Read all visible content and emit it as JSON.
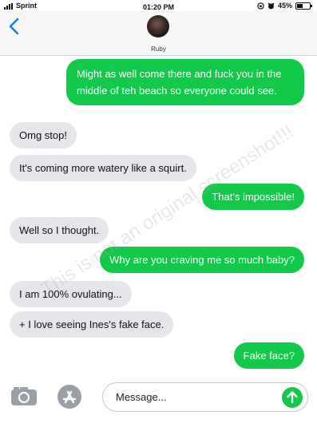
{
  "status_bar": {
    "carrier": "Sprint",
    "time": "01:20 PM",
    "battery_percent": "45%",
    "battery_level": 0.45
  },
  "header": {
    "contact_name": "Ruby"
  },
  "messages": [
    {
      "direction": "outgoing",
      "text": "Might as well come there and fuck you in the middle of teh beach so everyone could see."
    },
    {
      "direction": "incoming",
      "text": "Omg stop!"
    },
    {
      "direction": "incoming",
      "text": "It's coming more watery like a squirt."
    },
    {
      "direction": "outgoing",
      "text": "That's impossible!"
    },
    {
      "direction": "incoming",
      "text": "Well so I thought."
    },
    {
      "direction": "outgoing",
      "text": "Why are you craving me so much baby?"
    },
    {
      "direction": "incoming",
      "text": "I am 100% ovulating..."
    },
    {
      "direction": "incoming",
      "text": "+ I love seeing Ines's fake face."
    },
    {
      "direction": "outgoing",
      "text": "Fake face?"
    }
  ],
  "watermark": "This is not an original screenshot!!!",
  "composer": {
    "placeholder": "Message..."
  },
  "colors": {
    "outgoing_bubble": "#12c94a",
    "incoming_bubble": "#e6e5ea",
    "accent_blue": "#1a7cf5"
  },
  "icons": {
    "back": "chevron-left-icon",
    "camera": "camera-icon",
    "apps": "app-store-icon",
    "send": "arrow-up-icon"
  }
}
